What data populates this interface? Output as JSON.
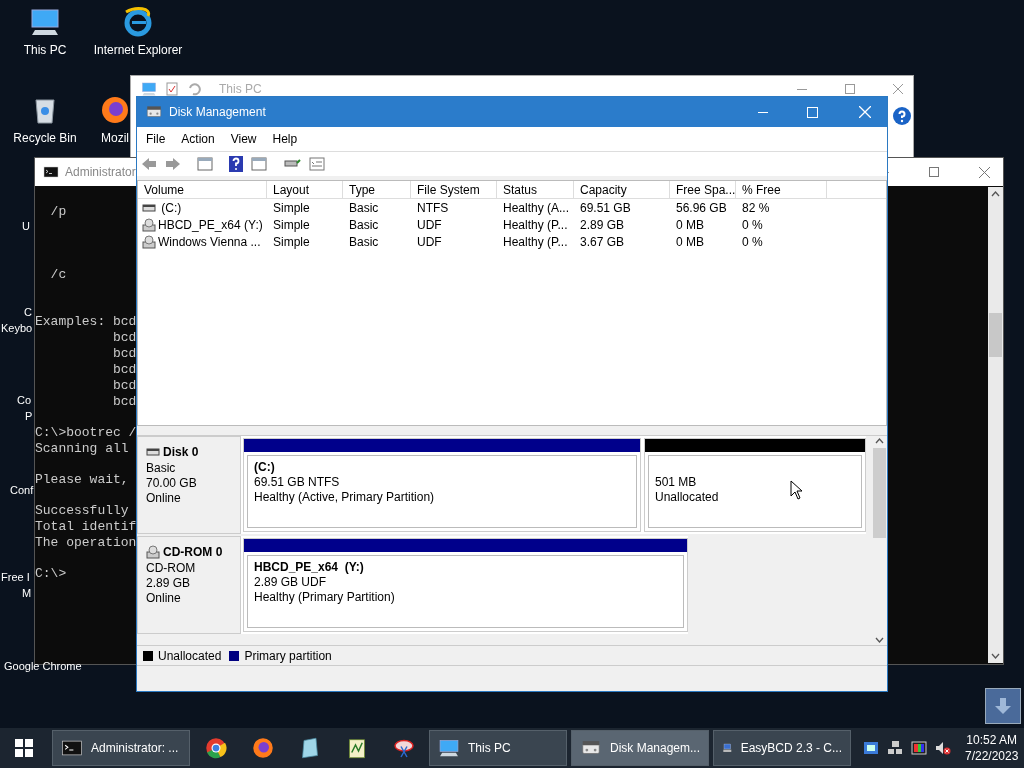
{
  "desktop": {
    "icons": [
      {
        "label": "This PC",
        "kind": "pc"
      },
      {
        "label": "Internet Explorer",
        "kind": "ie"
      },
      {
        "label": "Recycle Bin",
        "kind": "bin"
      },
      {
        "label": "Mozil",
        "kind": "firefox"
      }
    ],
    "covered_labels": [
      "U",
      "C",
      "Keybo",
      "Co",
      "P",
      "Conf",
      "Free I",
      "M",
      "Google Chrome"
    ]
  },
  "explorer": {
    "title": "This PC"
  },
  "cmd": {
    "title": "Administrator",
    "lines": [
      "  /p",
      "  /c",
      "Examples: bcd",
      "          bcd",
      "          bcd",
      "          bcd",
      "          bcd",
      "          bcd",
      "C:\\>bootrec /",
      "Scanning all",
      "Please wait,",
      "Successfully",
      "Total identif",
      "The operation",
      "C:\\>"
    ]
  },
  "disk_management": {
    "title": "Disk Management",
    "menu": [
      "File",
      "Action",
      "View",
      "Help"
    ],
    "columns": [
      "Volume",
      "Layout",
      "Type",
      "File System",
      "Status",
      "Capacity",
      "Free Spa...",
      "% Free"
    ],
    "volumes": [
      {
        "kind": "disk",
        "cells": [
          " (C:)",
          "Simple",
          "Basic",
          "NTFS",
          "Healthy (A...",
          "69.51 GB",
          "56.96 GB",
          "82 %"
        ]
      },
      {
        "kind": "cd",
        "cells": [
          "HBCD_PE_x64 (Y:)",
          "Simple",
          "Basic",
          "UDF",
          "Healthy (P...",
          "2.89 GB",
          "0 MB",
          "0 %"
        ]
      },
      {
        "kind": "cd",
        "cells": [
          "Windows Vienna ...",
          "Simple",
          "Basic",
          "UDF",
          "Healthy (P...",
          "3.67 GB",
          "0 MB",
          "0 %"
        ]
      }
    ],
    "disks": [
      {
        "kind": "disk",
        "name": "Disk 0",
        "lines": [
          "Basic",
          "70.00 GB",
          "Online"
        ],
        "partitions": [
          {
            "kind": "primary",
            "title": "(C:)",
            "lines": [
              "69.51 GB NTFS",
              "Healthy (Active, Primary Partition)"
            ]
          },
          {
            "kind": "unallocated",
            "lines": [
              "501 MB",
              "Unallocated"
            ]
          }
        ]
      },
      {
        "kind": "cd",
        "name": "CD-ROM 0",
        "lines": [
          "CD-ROM",
          "2.89 GB",
          "Online"
        ],
        "partitions": [
          {
            "kind": "primary",
            "title": "HBCD_PE_x64  (Y:)",
            "lines": [
              "2.89 GB UDF",
              "Healthy (Primary Partition)"
            ]
          }
        ]
      }
    ],
    "legend": [
      {
        "label": "Unallocated",
        "color": "#000000"
      },
      {
        "label": "Primary partition",
        "color": "#000080"
      }
    ]
  },
  "taskbar": {
    "buttons": [
      {
        "kind": "cmd",
        "label": "Administrator: ...",
        "selected": false
      },
      {
        "kind": "chrome",
        "selected": false
      },
      {
        "kind": "firefox",
        "selected": false
      },
      {
        "kind": "app",
        "selected": false
      },
      {
        "kind": "notepad",
        "selected": false
      },
      {
        "kind": "tool",
        "selected": false
      },
      {
        "kind": "explorer",
        "label": "This PC",
        "selected": false
      },
      {
        "kind": "disk",
        "label": "Disk Managem...",
        "selected": true
      },
      {
        "kind": "easybcd",
        "label": "EasyBCD 2.3 - C...",
        "selected": false
      }
    ],
    "time": "10:52 AM",
    "date": "7/22/2023"
  }
}
